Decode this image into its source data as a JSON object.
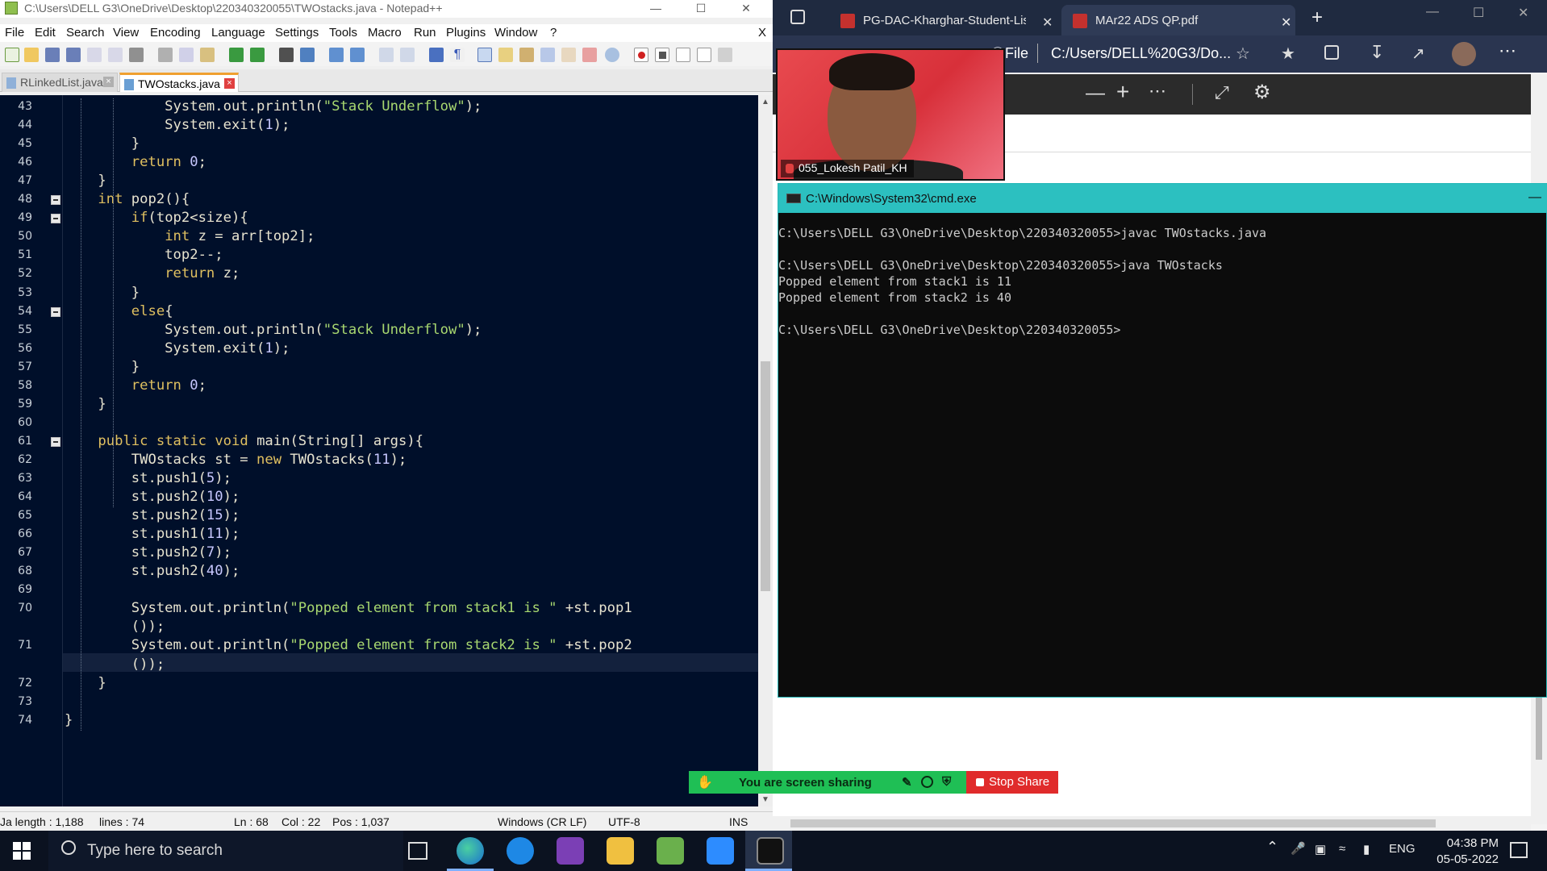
{
  "notepad": {
    "title": "C:\\Users\\DELL G3\\OneDrive\\Desktop\\220340320055\\TWOstacks.java - Notepad++",
    "close_x": "X",
    "menu": [
      "File",
      "Edit",
      "Search",
      "View",
      "Encoding",
      "Language",
      "Settings",
      "Tools",
      "Macro",
      "Run",
      "Plugins",
      "Window",
      "?"
    ],
    "tabs": [
      {
        "label": "RLinkedList.java"
      },
      {
        "label": "TWOstacks.java"
      }
    ],
    "lines": [
      {
        "n": "43",
        "code": "            System.out.println(\"Stack Underflow\");"
      },
      {
        "n": "44",
        "code": "            System.exit(1);"
      },
      {
        "n": "45",
        "code": "        }"
      },
      {
        "n": "46",
        "code": "        return 0;"
      },
      {
        "n": "47",
        "code": "    }"
      },
      {
        "n": "48",
        "code": "    int pop2(){"
      },
      {
        "n": "49",
        "code": "        if(top2<size){"
      },
      {
        "n": "50",
        "code": "            int z = arr[top2];"
      },
      {
        "n": "51",
        "code": "            top2--;"
      },
      {
        "n": "52",
        "code": "            return z;"
      },
      {
        "n": "53",
        "code": "        }"
      },
      {
        "n": "54",
        "code": "        else{"
      },
      {
        "n": "55",
        "code": "            System.out.println(\"Stack Underflow\");"
      },
      {
        "n": "56",
        "code": "            System.exit(1);"
      },
      {
        "n": "57",
        "code": "        }"
      },
      {
        "n": "58",
        "code": "        return 0;"
      },
      {
        "n": "59",
        "code": "    }"
      },
      {
        "n": "60",
        "code": ""
      },
      {
        "n": "61",
        "code": "    public static void main(String[] args){"
      },
      {
        "n": "62",
        "code": "        TWOstacks st = new TWOstacks(11);"
      },
      {
        "n": "63",
        "code": "        st.push1(5);"
      },
      {
        "n": "64",
        "code": "        st.push2(10);"
      },
      {
        "n": "65",
        "code": "        st.push2(15);"
      },
      {
        "n": "66",
        "code": "        st.push1(11);"
      },
      {
        "n": "67",
        "code": "        st.push2(7);"
      },
      {
        "n": "68",
        "code": "        st.push2(40);"
      },
      {
        "n": "69",
        "code": ""
      },
      {
        "n": "70",
        "code": "        System.out.println(\"Popped element from stack1 is \" +st.pop1"
      },
      {
        "n": "",
        "code": "        ());"
      },
      {
        "n": "71",
        "code": "        System.out.println(\"Popped element from stack2 is \" +st.pop2"
      },
      {
        "n": "",
        "code": "        ());"
      },
      {
        "n": "72",
        "code": "    }"
      },
      {
        "n": "73",
        "code": ""
      },
      {
        "n": "74",
        "code": "}"
      }
    ],
    "status": {
      "length": "Ja length : 1,188",
      "lines": "lines : 74",
      "ln": "Ln : 68",
      "col": "Col : 22",
      "pos": "Pos : 1,037",
      "eol": "Windows (CR LF)",
      "encoding": "UTF-8",
      "mode": "INS"
    }
  },
  "edge": {
    "tabs": [
      {
        "label": "PG-DAC-Kharghar-Student-List.p"
      },
      {
        "label": "MAr22 ADS QP.pdf"
      }
    ],
    "address": {
      "scheme_label": "File",
      "url": "C:/Users/DELL%20G3/Do..."
    }
  },
  "webcam": {
    "name": "055_Lokesh Patil_KH"
  },
  "cmd": {
    "title": "C:\\Windows\\System32\\cmd.exe",
    "lines": [
      "C:\\Users\\DELL G3\\OneDrive\\Desktop\\220340320055>javac TWOstacks.java",
      "",
      "C:\\Users\\DELL G3\\OneDrive\\Desktop\\220340320055>java TWOstacks",
      "Popped element from stack1 is 11",
      "Popped element from stack2 is 40",
      "",
      "C:\\Users\\DELL G3\\OneDrive\\Desktop\\220340320055>"
    ]
  },
  "share": {
    "status": "You are screen sharing",
    "stop_label": "Stop Share"
  },
  "taskbar": {
    "search_placeholder": "Type here to search",
    "language": "ENG",
    "time": "04:38 PM",
    "date": "05-05-2022"
  },
  "colors": {
    "editor_bg": "#000f2a",
    "cmd_title": "#2cc0c0",
    "share_green": "#1fbf55",
    "stop_red": "#e02b2b"
  }
}
